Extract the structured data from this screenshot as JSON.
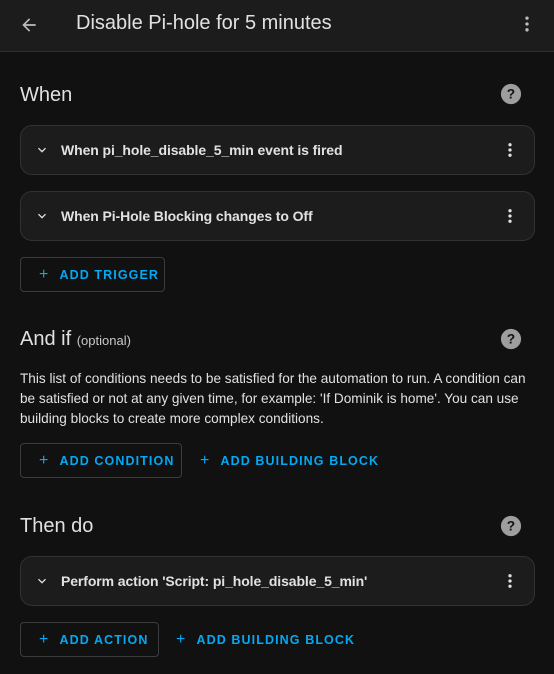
{
  "header": {
    "title": "Disable Pi-hole for 5 minutes",
    "back_icon": "arrow-left-icon",
    "menu_icon": "dots-vertical-icon"
  },
  "triggers_section": {
    "title": "When",
    "help_icon": "help-circle-icon",
    "items": [
      {
        "label": "When pi_hole_disable_5_min event is fired"
      },
      {
        "label": "When Pi-Hole Blocking changes to Off"
      }
    ],
    "add_label": "ADD TRIGGER"
  },
  "conditions_section": {
    "title": "And if",
    "optional": "(optional)",
    "description": "This list of conditions needs to be satisfied for the automation to run. A condition can be satisfied or not at any given time, for example: 'If Dominik is home'. You can use building blocks to create more complex conditions.",
    "add_label": "ADD CONDITION",
    "building_block_label": "ADD BUILDING BLOCK"
  },
  "actions_section": {
    "title": "Then do",
    "items": [
      {
        "label": "Perform action 'Script: pi_hole_disable_5_min'"
      }
    ],
    "add_label": "ADD ACTION",
    "building_block_label": "ADD BUILDING BLOCK"
  },
  "colors": {
    "accent": "#03a9f4",
    "background": "#111111",
    "card": "#1c1c1c",
    "text": "#e1e1e1"
  }
}
